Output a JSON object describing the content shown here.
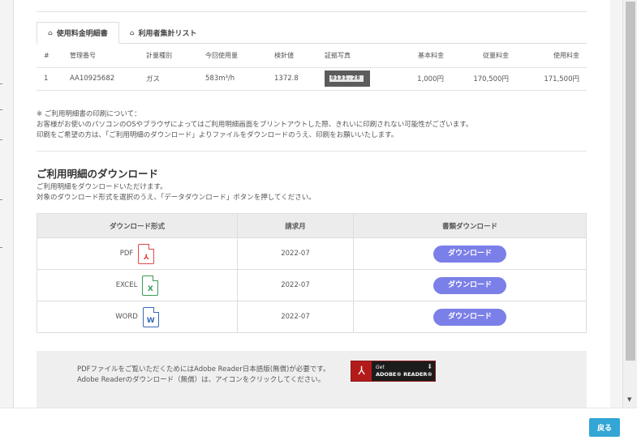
{
  "tabs": [
    {
      "label": "使用料金明細書",
      "icon": "home-icon",
      "active": true
    },
    {
      "label": "利用者集計リスト",
      "icon": "home-icon",
      "active": false
    }
  ],
  "usage_table": {
    "headers": [
      "#",
      "管理番号",
      "計量種別",
      "今回使用量",
      "検針値",
      "証拠写真",
      "基本料金",
      "従量料金",
      "使用料金"
    ],
    "rows": [
      {
        "no": "1",
        "id": "AA10925682",
        "type": "ガス",
        "usage": "583m³/h",
        "reading": "1372.8",
        "photo_text": "0131.28",
        "basic": "1,000円",
        "metered": "170,500円",
        "total": "171,500円"
      }
    ]
  },
  "notes": [
    "※ ご利用明細書の印刷について：",
    "お客様がお使いのパソコンのOSやブラウザによってはご利用明細画面をプリントアウトした際、きれいに印刷されない可能性がございます。",
    "印刷をご希望の方は、「ご利用明細のダウンロード」よりファイルをダウンロードのうえ、印刷をお願いいたします。"
  ],
  "download": {
    "title": "ご利用明細のダウンロード",
    "desc": [
      "ご利用明細をダウンロードいただけます。",
      "対象のダウンロード形式を選択のうえ、「データダウンロード」ボタンを押してください。"
    ],
    "headers": [
      "ダウンロード形式",
      "請求月",
      "書類ダウンロード"
    ],
    "rows": [
      {
        "format": "PDF",
        "icon_letter": "⅄",
        "month": "2022-07",
        "button": "ダウンロード"
      },
      {
        "format": "EXCEL",
        "icon_letter": "X",
        "month": "2022-07",
        "button": "ダウンロード"
      },
      {
        "format": "WORD",
        "icon_letter": "W",
        "month": "2022-07",
        "button": "ダウンロード"
      }
    ]
  },
  "adobe": {
    "lines": [
      "PDFファイルをご覧いただくためにはAdobe Reader日本語版(無償)が必要です。",
      "Adobe Readerのダウンロード（無償）は、アイコンをクリックしてください。"
    ],
    "badge_get": "Get",
    "badge_name": "ADOBE® READER®"
  },
  "footer": {
    "back_label": "戻る"
  },
  "colors": {
    "download_button": "#7b7fe8",
    "back_button": "#33a6d6",
    "pdf": "#e04848",
    "excel": "#3a9a55",
    "word": "#3a68b8"
  }
}
